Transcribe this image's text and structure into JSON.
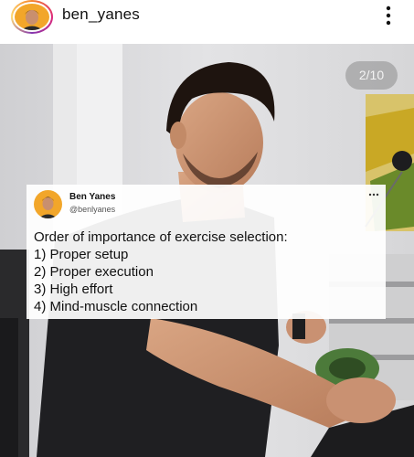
{
  "post": {
    "username": "ben_yanes",
    "menu_icon": "more-vertical-icon",
    "avatar_icon": "profile-avatar-icon"
  },
  "carousel": {
    "counter": "2/10"
  },
  "tweet": {
    "name": "Ben Yanes",
    "handle": "@benlyanes",
    "menu_icon": "more-horizontal-icon",
    "lines": [
      "Order of importance of exercise selection:",
      "1) Proper setup",
      "2) Proper execution",
      "3) High effort",
      "4) Mind-muscle connection"
    ]
  },
  "colors": {
    "avatar_fill": "#f2a62a",
    "story_ring": "#dd2a7b",
    "text": "#111111"
  }
}
